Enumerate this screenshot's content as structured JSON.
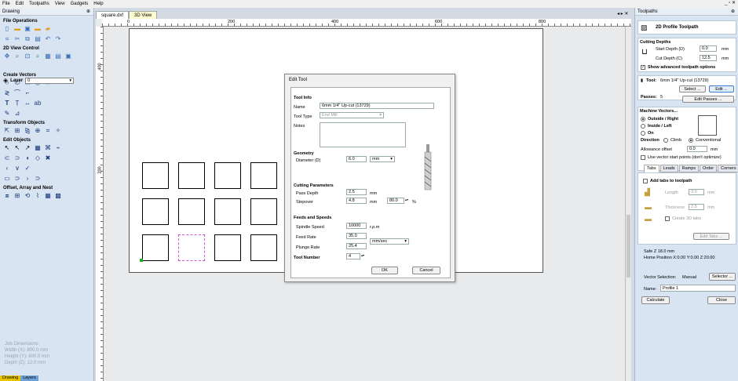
{
  "menu": [
    "File",
    "Edit",
    "Toolpaths",
    "View",
    "Gadgets",
    "Help"
  ],
  "left_panel": {
    "title": "Drawing",
    "sections": {
      "file_ops": "File Operations",
      "view_control": "2D View Control",
      "layer_label": "Layer",
      "layer_value": "0",
      "create_vectors": "Create Vectors",
      "transform": "Transform Objects",
      "edit_objects": "Edit Objects",
      "offset": "Offset, Array and Nest"
    },
    "job_dim": {
      "title": "Job Dimensions",
      "width": "Width  (X): 800.0 mm",
      "height": "Height (Y): 800.0 mm",
      "depth": "Depth  (Z): 12.0 mm"
    },
    "bottom_tabs": [
      "Drawing",
      "Layers"
    ]
  },
  "doc_tabs": [
    "square.dxf",
    "3D View"
  ],
  "ruler": {
    "top": [
      "0",
      "200",
      "400",
      "600",
      "800"
    ],
    "left": [
      "400",
      "200"
    ]
  },
  "right_panel": {
    "title": "Toolpaths",
    "header": "2D Profile Toolpath",
    "cutting_depths": "Cutting Depths",
    "start_depth_label": "Start Depth (D)",
    "start_depth": "0.0",
    "cut_depth_label": "Cut Depth (C)",
    "cut_depth": "12.5",
    "unit": "mm",
    "show_advanced": "Show advanced toolpath options",
    "tool_label": "Tool:",
    "tool_value": "6mm 1/4\" Up-cut (13729)",
    "select_btn": "Select ...",
    "edit_btn": "Edit ...",
    "passes_label": "Passes:",
    "passes_value": "5",
    "edit_passes_btn": "Edit Passes ...",
    "machine_vectors": "Machine Vectors...",
    "outside": "Outside / Right",
    "inside": "Inside / Left",
    "on": "On",
    "direction": "Direction",
    "climb": "Climb",
    "conventional": "Conventional",
    "allowance_label": "Allowance offset",
    "allowance_value": "0.0",
    "vector_start": "Use vector start points (don't optimize)",
    "tabs": [
      "Tabs",
      "Leads",
      "Ramps",
      "Order",
      "Corners"
    ],
    "add_tabs": "Add tabs to toolpath",
    "length_label": "Length",
    "length_value": "3.0",
    "thickness_label": "Thickness",
    "thickness_value": "2.5",
    "create_3d": "Create 3D tabs",
    "edit_tabs_btn": "Edit Tabs ...",
    "safe_z": "Safe Z        18.0 mm",
    "home_pos": "Home Position  X:0.00 Y:0.00 Z:20.00",
    "vector_sel_label": "Vector Selection:",
    "vector_sel_value": "Manual",
    "selector_btn": "Selector ...",
    "name_label": "Name:",
    "name_value": "Profile 1",
    "calculate_btn": "Calculate",
    "close_btn": "Close"
  },
  "dialog": {
    "title": "Edit Tool",
    "tool_info": "Tool Info",
    "name_label": "Name",
    "name_value": "6mm 1/4\" Up-cut (13729)",
    "type_label": "Tool Type",
    "type_value": "End Mill",
    "notes_label": "Notes",
    "geometry": "Geometry",
    "diameter_label": "Diameter (D)",
    "diameter_value": "6.0",
    "diameter_unit": "mm",
    "cutting_params": "Cutting Parameters",
    "pass_depth_label": "Pass Depth",
    "pass_depth_value": "2.5",
    "stepover_label": "Stepover",
    "stepover_value": "4.8",
    "stepover_pct": "80.0",
    "mm": "mm",
    "pct": "%",
    "feeds": "Feeds and Speeds",
    "spindle_label": "Spindle Speed",
    "spindle_value": "10000",
    "rpm": "r.p.m",
    "feed_label": "Feed Rate",
    "feed_value": "35.0",
    "feed_unit": "mm/sec",
    "plunge_label": "Plunge Rate",
    "plunge_value": "25.4",
    "tool_number_label": "Tool Number",
    "tool_number_value": "4",
    "ok": "OK",
    "cancel": "Cancel"
  }
}
